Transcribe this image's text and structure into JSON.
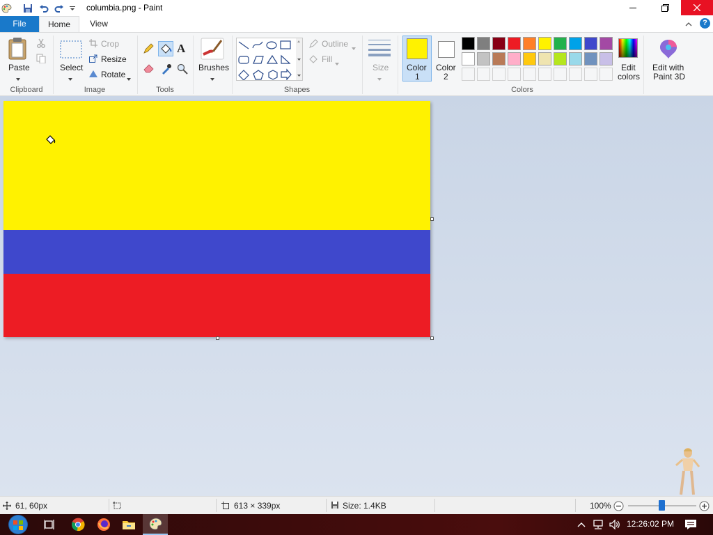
{
  "window": {
    "title": "columbia.png - Paint",
    "controls": [
      "minimize",
      "maximize",
      "close"
    ]
  },
  "tabs": [
    {
      "label": "File",
      "active": false
    },
    {
      "label": "Home",
      "active": true
    },
    {
      "label": "View",
      "active": false
    }
  ],
  "ribbon": {
    "clipboard": {
      "paste_label": "Paste",
      "group_label": "Clipboard"
    },
    "image": {
      "select_label": "Select",
      "crop_label": "Crop",
      "resize_label": "Resize",
      "rotate_label": "Rotate",
      "group_label": "Image"
    },
    "tools": {
      "group_label": "Tools"
    },
    "brushes": {
      "label": "Brushes"
    },
    "shapes": {
      "outline_label": "Outline",
      "fill_label": "Fill",
      "group_label": "Shapes"
    },
    "size": {
      "label": "Size"
    },
    "colors": {
      "color1_label": "Color",
      "color1_num": "1",
      "color2_label": "Color",
      "color2_num": "2",
      "color1_value": "#fff200",
      "color2_value": "#ffffff",
      "edit_colors_label": "Edit",
      "edit_colors_label2": "colors",
      "paint3d_label": "Edit with",
      "paint3d_label2": "Paint 3D",
      "group_label": "Colors",
      "palette_row1": [
        "#000000",
        "#7f7f7f",
        "#880015",
        "#ed1c24",
        "#ff7f27",
        "#fff200",
        "#22b14c",
        "#00a2e8",
        "#3f48cc",
        "#a349a4"
      ],
      "palette_row2": [
        "#ffffff",
        "#c3c3c3",
        "#b97a57",
        "#ffaec9",
        "#ffc90e",
        "#efe4b0",
        "#b5e61d",
        "#99d9ea",
        "#7092be",
        "#c8bfe7"
      ]
    }
  },
  "canvas": {
    "stripes": [
      {
        "name": "yellow",
        "color": "#fff200"
      },
      {
        "name": "blue",
        "color": "#3f48cc"
      },
      {
        "name": "red",
        "color": "#ed1c24"
      }
    ]
  },
  "status": {
    "cursor_pos": "61, 60px",
    "image_size": "613 × 339px",
    "file_size": "Size: 1.4KB",
    "zoom": "100%"
  },
  "taskbar": {
    "clock": "12:26:02 PM"
  }
}
